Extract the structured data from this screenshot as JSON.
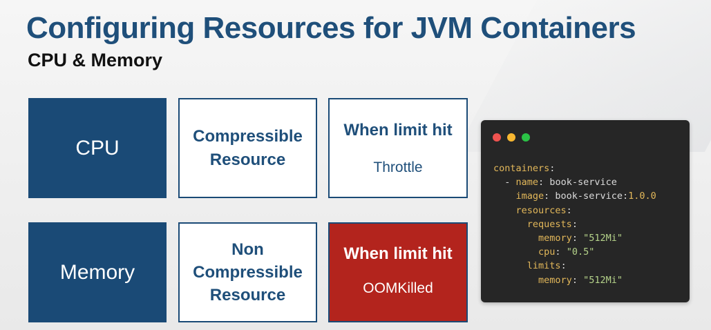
{
  "slide": {
    "title": "Configuring Resources for JVM Containers",
    "subtitle": "CPU & Memory"
  },
  "rows": [
    {
      "label": "CPU",
      "type_lines": [
        "Compressible",
        "Resource"
      ],
      "limit_heading": "When limit hit",
      "limit_action": "Throttle"
    },
    {
      "label": "Memory",
      "type_lines": [
        "Non",
        "Compressible",
        "Resource"
      ],
      "limit_heading": "When limit hit",
      "limit_action": "OOMKilled"
    }
  ],
  "code_window": {
    "lines": [
      {
        "key": "containers",
        "sep": ":",
        "value": ""
      },
      {
        "prefix": "- ",
        "key": "name",
        "sep": ": ",
        "value": "book-service"
      },
      {
        "key": "image",
        "sep": ": ",
        "value": "book-service:",
        "num": "1.0.0"
      },
      {
        "key": "resources",
        "sep": ":",
        "value": ""
      },
      {
        "key": "requests",
        "sep": ":",
        "value": ""
      },
      {
        "key": "memory",
        "sep": ": ",
        "str": "\"512Mi\""
      },
      {
        "key": "cpu",
        "sep": ": ",
        "str": "\"0.5\""
      },
      {
        "key": "limits",
        "sep": ":",
        "value": ""
      },
      {
        "key": "memory",
        "sep": ": ",
        "str": "\"512Mi\""
      }
    ]
  },
  "colors": {
    "title_blue": "#1f4f7a",
    "box_dark_blue": "#1a4a76",
    "oom_red": "#b3241d",
    "editor_bg": "#262626",
    "window_close": "#ef5350",
    "window_minimize": "#f7b731",
    "window_maximize": "#2bc246"
  }
}
